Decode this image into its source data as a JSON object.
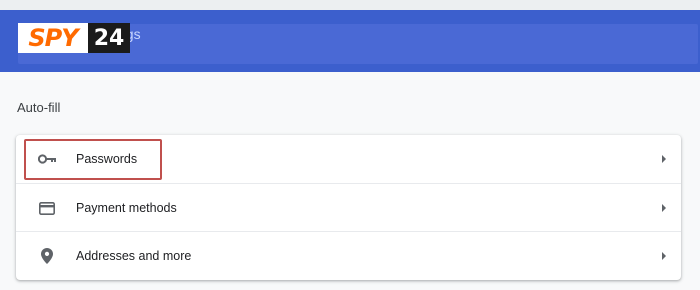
{
  "header": {
    "logo_spy": "SPY",
    "logo_num": "24",
    "title_fragment": "ngs"
  },
  "section": {
    "label": "Auto-fill"
  },
  "rows": [
    {
      "label": "Passwords",
      "icon": "key-icon"
    },
    {
      "label": "Payment methods",
      "icon": "credit-card-icon"
    },
    {
      "label": "Addresses and more",
      "icon": "location-pin-icon"
    }
  ],
  "colors": {
    "header": "#3c5fcd",
    "logo_orange": "#ff6a00",
    "highlight_border": "#c0504d"
  }
}
